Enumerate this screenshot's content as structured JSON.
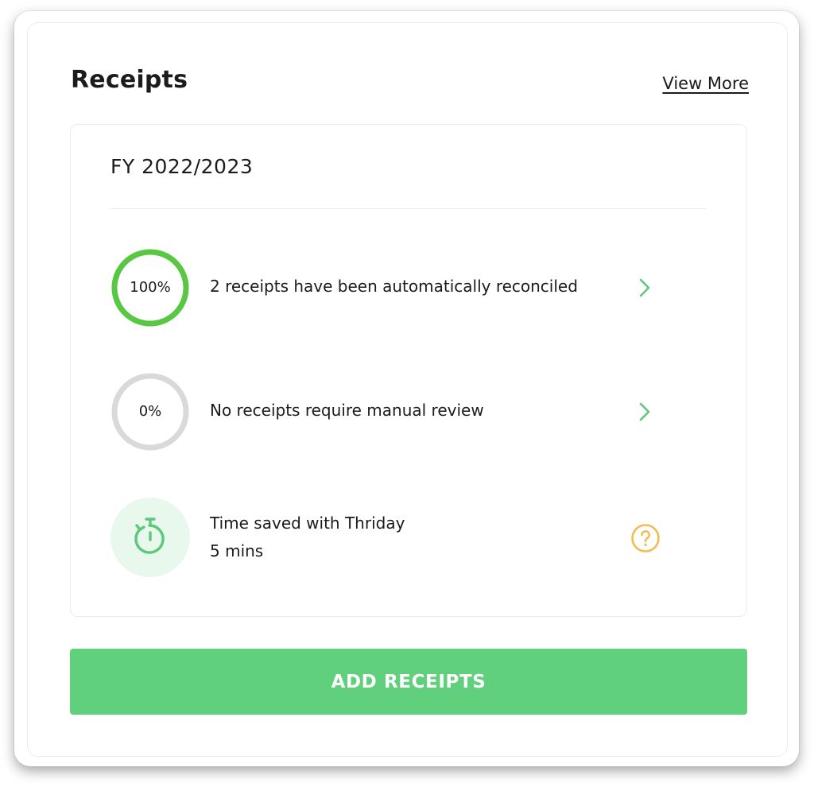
{
  "header": {
    "title": "Receipts",
    "view_more_label": "View More"
  },
  "summary": {
    "period": "FY 2022/2023",
    "items": [
      {
        "progress_label": "100%",
        "progress": 1.0,
        "text": "2 receipts have been automatically reconciled",
        "ring_color": "#58c742",
        "action_icon": "chevron-right-icon"
      },
      {
        "progress_label": "0%",
        "progress": 0.0,
        "text": "No receipts require manual review",
        "ring_color": "#d9d9d9",
        "action_icon": "chevron-right-icon"
      }
    ],
    "time_saved": {
      "label": "Time saved with Thriday",
      "value": "5 mins",
      "icon": "timer-icon",
      "help_icon": "question-circle-icon"
    }
  },
  "actions": {
    "add_receipts_label": "ADD RECEIPTS"
  },
  "colors": {
    "accent_green": "#61d07c",
    "chevron_green": "#5cc97a",
    "help_yellow": "#f0bd52",
    "timer_green": "#5cc97a",
    "timer_bg": "#e8f8ed"
  }
}
